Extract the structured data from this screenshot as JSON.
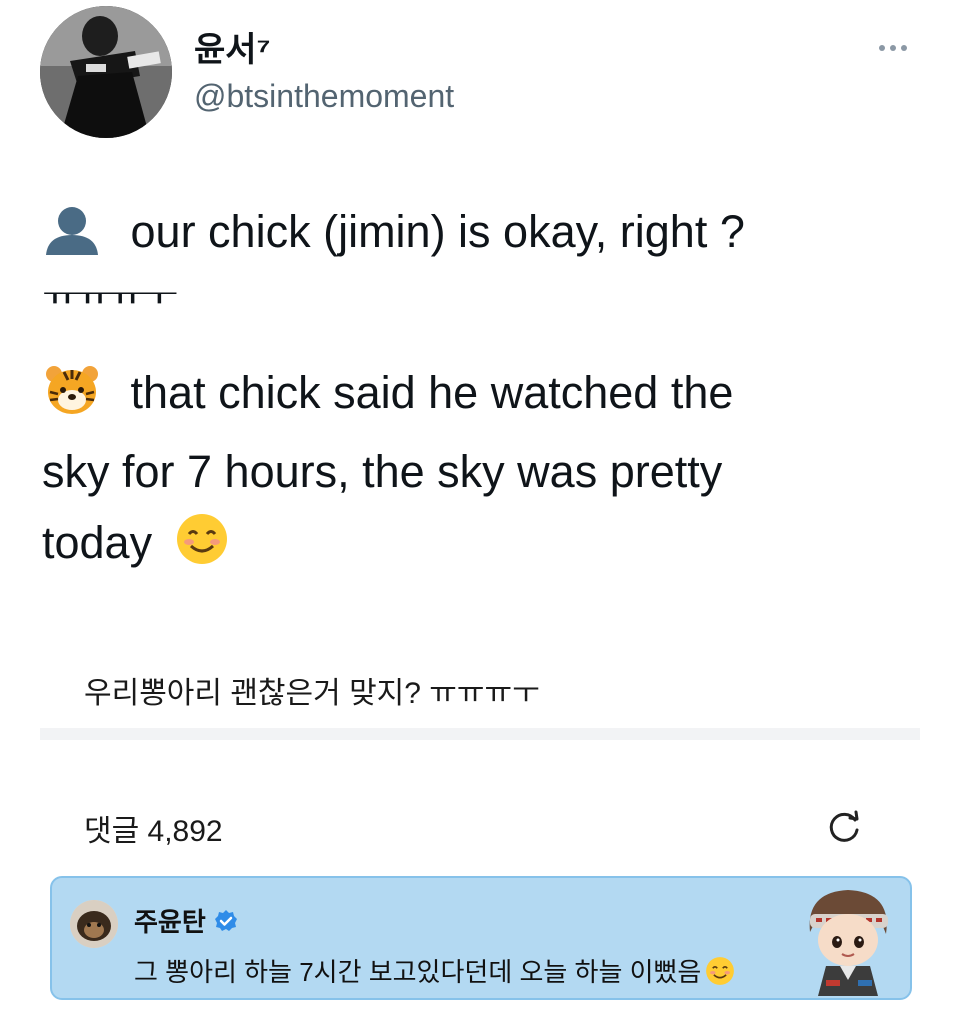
{
  "author": {
    "display_name": "윤서⁷",
    "handle": "@btsinthemoment"
  },
  "tweet": {
    "line1": "our chick (jimin) is okay, right ?",
    "line2": "ㅠㅠㅠㅜ",
    "line3": "that chick said he watched the",
    "line4": "sky for 7 hours, the sky was pretty",
    "line5": "today"
  },
  "quoted": {
    "text": "우리뽕아리 괜찮은거 맞지? ㅠㅠㅠㅜ",
    "comments_label": "댓글 4,892"
  },
  "comment": {
    "author": "주윤탄",
    "text": "그 뽕아리 하늘 7시간 보고있다던데 오늘 하늘 이뻤음"
  },
  "icons": {
    "avatar": "profile-photo",
    "more": "more-dots-icon",
    "person": "bust-silhouette-icon",
    "tiger": "tiger-face-icon",
    "smile": "smiling-face-icon",
    "refresh": "refresh-icon",
    "verified": "verified-badge-icon"
  },
  "colors": {
    "handle": "#536471",
    "comment_bg": "#b3d9f2",
    "verified": "#2f8ce8"
  }
}
